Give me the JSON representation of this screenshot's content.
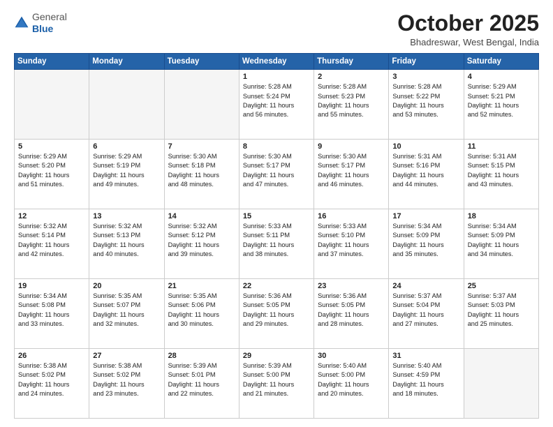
{
  "header": {
    "logo_general": "General",
    "logo_blue": "Blue",
    "month_title": "October 2025",
    "location": "Bhadreswar, West Bengal, India"
  },
  "days_of_week": [
    "Sunday",
    "Monday",
    "Tuesday",
    "Wednesday",
    "Thursday",
    "Friday",
    "Saturday"
  ],
  "weeks": [
    [
      {
        "num": "",
        "info": "",
        "empty": true
      },
      {
        "num": "",
        "info": "",
        "empty": true
      },
      {
        "num": "",
        "info": "",
        "empty": true
      },
      {
        "num": "1",
        "info": "Sunrise: 5:28 AM\nSunset: 5:24 PM\nDaylight: 11 hours\nand 56 minutes."
      },
      {
        "num": "2",
        "info": "Sunrise: 5:28 AM\nSunset: 5:23 PM\nDaylight: 11 hours\nand 55 minutes."
      },
      {
        "num": "3",
        "info": "Sunrise: 5:28 AM\nSunset: 5:22 PM\nDaylight: 11 hours\nand 53 minutes."
      },
      {
        "num": "4",
        "info": "Sunrise: 5:29 AM\nSunset: 5:21 PM\nDaylight: 11 hours\nand 52 minutes."
      }
    ],
    [
      {
        "num": "5",
        "info": "Sunrise: 5:29 AM\nSunset: 5:20 PM\nDaylight: 11 hours\nand 51 minutes."
      },
      {
        "num": "6",
        "info": "Sunrise: 5:29 AM\nSunset: 5:19 PM\nDaylight: 11 hours\nand 49 minutes."
      },
      {
        "num": "7",
        "info": "Sunrise: 5:30 AM\nSunset: 5:18 PM\nDaylight: 11 hours\nand 48 minutes."
      },
      {
        "num": "8",
        "info": "Sunrise: 5:30 AM\nSunset: 5:17 PM\nDaylight: 11 hours\nand 47 minutes."
      },
      {
        "num": "9",
        "info": "Sunrise: 5:30 AM\nSunset: 5:17 PM\nDaylight: 11 hours\nand 46 minutes."
      },
      {
        "num": "10",
        "info": "Sunrise: 5:31 AM\nSunset: 5:16 PM\nDaylight: 11 hours\nand 44 minutes."
      },
      {
        "num": "11",
        "info": "Sunrise: 5:31 AM\nSunset: 5:15 PM\nDaylight: 11 hours\nand 43 minutes."
      }
    ],
    [
      {
        "num": "12",
        "info": "Sunrise: 5:32 AM\nSunset: 5:14 PM\nDaylight: 11 hours\nand 42 minutes."
      },
      {
        "num": "13",
        "info": "Sunrise: 5:32 AM\nSunset: 5:13 PM\nDaylight: 11 hours\nand 40 minutes."
      },
      {
        "num": "14",
        "info": "Sunrise: 5:32 AM\nSunset: 5:12 PM\nDaylight: 11 hours\nand 39 minutes."
      },
      {
        "num": "15",
        "info": "Sunrise: 5:33 AM\nSunset: 5:11 PM\nDaylight: 11 hours\nand 38 minutes."
      },
      {
        "num": "16",
        "info": "Sunrise: 5:33 AM\nSunset: 5:10 PM\nDaylight: 11 hours\nand 37 minutes."
      },
      {
        "num": "17",
        "info": "Sunrise: 5:34 AM\nSunset: 5:09 PM\nDaylight: 11 hours\nand 35 minutes."
      },
      {
        "num": "18",
        "info": "Sunrise: 5:34 AM\nSunset: 5:09 PM\nDaylight: 11 hours\nand 34 minutes."
      }
    ],
    [
      {
        "num": "19",
        "info": "Sunrise: 5:34 AM\nSunset: 5:08 PM\nDaylight: 11 hours\nand 33 minutes."
      },
      {
        "num": "20",
        "info": "Sunrise: 5:35 AM\nSunset: 5:07 PM\nDaylight: 11 hours\nand 32 minutes."
      },
      {
        "num": "21",
        "info": "Sunrise: 5:35 AM\nSunset: 5:06 PM\nDaylight: 11 hours\nand 30 minutes."
      },
      {
        "num": "22",
        "info": "Sunrise: 5:36 AM\nSunset: 5:05 PM\nDaylight: 11 hours\nand 29 minutes."
      },
      {
        "num": "23",
        "info": "Sunrise: 5:36 AM\nSunset: 5:05 PM\nDaylight: 11 hours\nand 28 minutes."
      },
      {
        "num": "24",
        "info": "Sunrise: 5:37 AM\nSunset: 5:04 PM\nDaylight: 11 hours\nand 27 minutes."
      },
      {
        "num": "25",
        "info": "Sunrise: 5:37 AM\nSunset: 5:03 PM\nDaylight: 11 hours\nand 25 minutes."
      }
    ],
    [
      {
        "num": "26",
        "info": "Sunrise: 5:38 AM\nSunset: 5:02 PM\nDaylight: 11 hours\nand 24 minutes."
      },
      {
        "num": "27",
        "info": "Sunrise: 5:38 AM\nSunset: 5:02 PM\nDaylight: 11 hours\nand 23 minutes."
      },
      {
        "num": "28",
        "info": "Sunrise: 5:39 AM\nSunset: 5:01 PM\nDaylight: 11 hours\nand 22 minutes."
      },
      {
        "num": "29",
        "info": "Sunrise: 5:39 AM\nSunset: 5:00 PM\nDaylight: 11 hours\nand 21 minutes."
      },
      {
        "num": "30",
        "info": "Sunrise: 5:40 AM\nSunset: 5:00 PM\nDaylight: 11 hours\nand 20 minutes."
      },
      {
        "num": "31",
        "info": "Sunrise: 5:40 AM\nSunset: 4:59 PM\nDaylight: 11 hours\nand 18 minutes."
      },
      {
        "num": "",
        "info": "",
        "empty": true
      }
    ]
  ]
}
